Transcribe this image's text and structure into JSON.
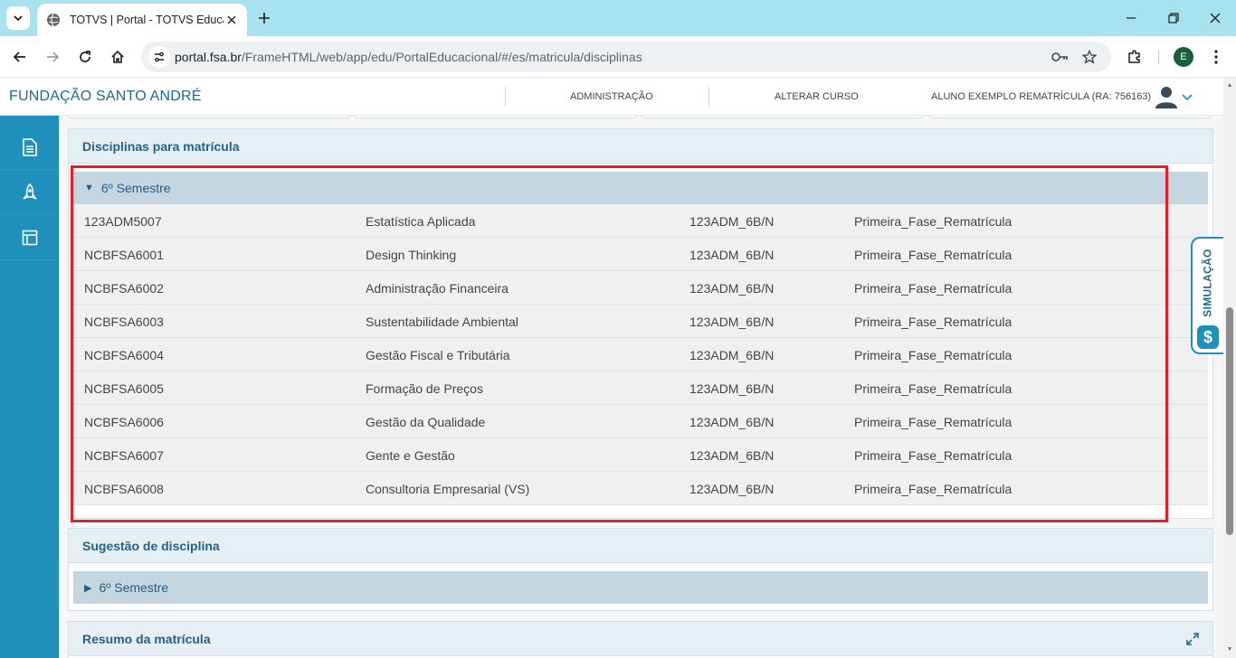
{
  "browser": {
    "tab_title": "TOTVS | Portal - TOTVS Educacional",
    "url_host": "portal.fsa.br",
    "url_path": "/FrameHTML/web/app/edu/PortalEducacional/#/es/matricula/disciplinas",
    "profile_initial": "E"
  },
  "header": {
    "brand": "FUNDAÇÃO SANTO ANDRÉ",
    "admin_link": "ADMINISTRAÇÃO",
    "change_course_link": "ALTERAR CURSO",
    "student": "ALUNO EXEMPLO REMATRÍCULA (RA: 756163)"
  },
  "enrollment": {
    "title": "Disciplinas para matrícula",
    "group_label": "6º Semestre",
    "rows": [
      {
        "code": "123ADM5007",
        "name": "Estatística Aplicada",
        "class": "123ADM_6B/N",
        "phase": "Primeira_Fase_Rematrícula"
      },
      {
        "code": "NCBFSA6001",
        "name": "Design Thinking",
        "class": "123ADM_6B/N",
        "phase": "Primeira_Fase_Rematrícula"
      },
      {
        "code": "NCBFSA6002",
        "name": "Administração Financeira",
        "class": "123ADM_6B/N",
        "phase": "Primeira_Fase_Rematrícula"
      },
      {
        "code": "NCBFSA6003",
        "name": "Sustentabilidade Ambiental",
        "class": "123ADM_6B/N",
        "phase": "Primeira_Fase_Rematrícula"
      },
      {
        "code": "NCBFSA6004",
        "name": "Gestão Fiscal e Tributária",
        "class": "123ADM_6B/N",
        "phase": "Primeira_Fase_Rematrícula"
      },
      {
        "code": "NCBFSA6005",
        "name": "Formação de Preços",
        "class": "123ADM_6B/N",
        "phase": "Primeira_Fase_Rematrícula"
      },
      {
        "code": "NCBFSA6006",
        "name": "Gestão da Qualidade",
        "class": "123ADM_6B/N",
        "phase": "Primeira_Fase_Rematrícula"
      },
      {
        "code": "NCBFSA6007",
        "name": "Gente e Gestão",
        "class": "123ADM_6B/N",
        "phase": "Primeira_Fase_Rematrícula"
      },
      {
        "code": "NCBFSA6008",
        "name": "Consultoria Empresarial (VS)",
        "class": "123ADM_6B/N",
        "phase": "Primeira_Fase_Rematrícula"
      }
    ]
  },
  "suggestion": {
    "title": "Sugestão de disciplina",
    "group_label": "6º Semestre"
  },
  "summary": {
    "title": "Resumo da matrícula"
  },
  "simulation_tab": {
    "label": "SIMULAÇÃO",
    "icon": "$"
  },
  "colors": {
    "sidebar": "#1f8fbb",
    "brand": "#1a6a98",
    "highlight": "#e2202c"
  }
}
